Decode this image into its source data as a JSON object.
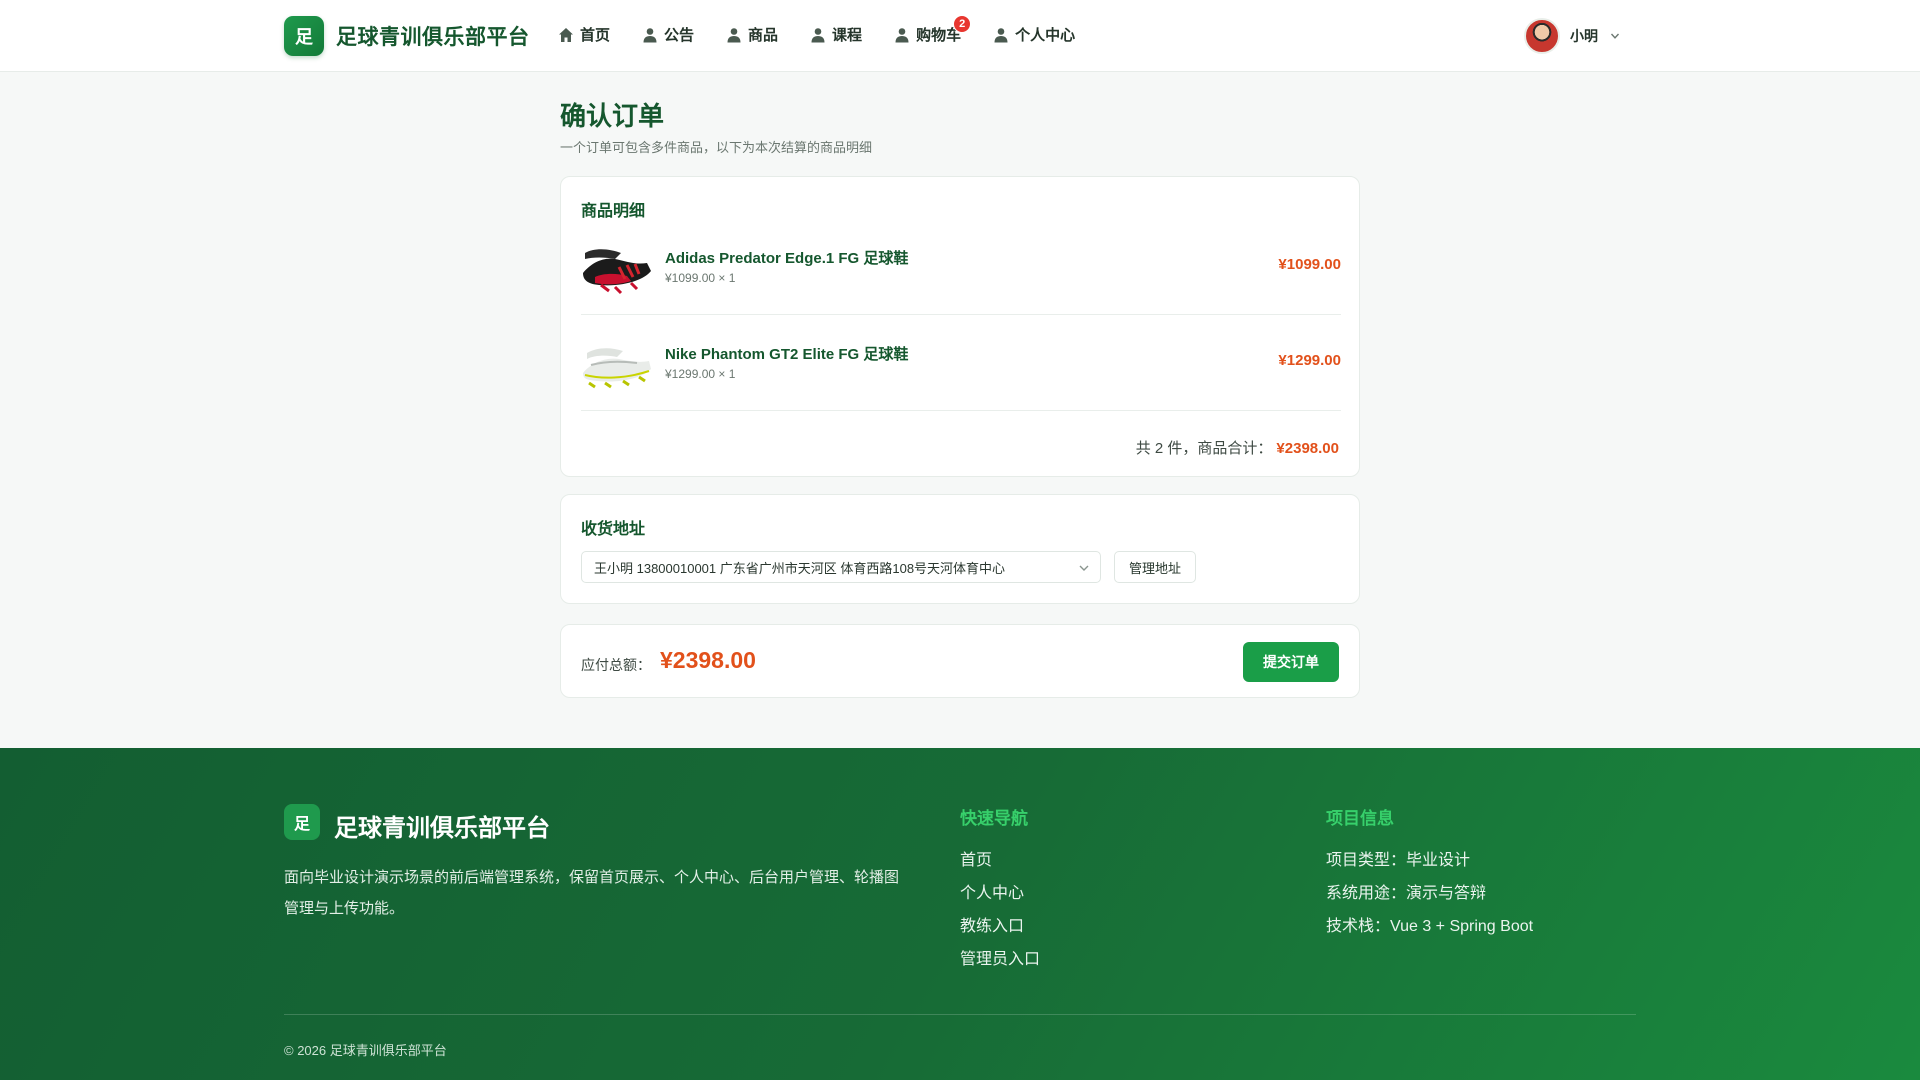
{
  "header": {
    "brand_logo": "足",
    "brand_title": "足球青训俱乐部平台",
    "nav": [
      {
        "label": "首页",
        "icon": "home-icon"
      },
      {
        "label": "公告",
        "icon": "user-icon"
      },
      {
        "label": "商品",
        "icon": "user-icon"
      },
      {
        "label": "课程",
        "icon": "user-icon"
      },
      {
        "label": "购物车",
        "icon": "user-icon",
        "badge": "2"
      },
      {
        "label": "个人中心",
        "icon": "user-icon"
      }
    ],
    "user_name": "小明"
  },
  "page": {
    "title": "确认订单",
    "subtitle": "一个订单可包含多件商品，以下为本次结算的商品明细"
  },
  "goods": {
    "heading": "商品明细",
    "items": [
      {
        "name": "Adidas Predator Edge.1 FG 足球鞋",
        "unit": "¥1099.00 × 1",
        "subtotal": "¥1099.00"
      },
      {
        "name": "Nike Phantom GT2 Elite FG 足球鞋",
        "unit": "¥1299.00 × 1",
        "subtotal": "¥1299.00"
      }
    ],
    "summary_text": "共 2 件，商品合计：",
    "summary_amount": "¥2398.00"
  },
  "address": {
    "heading": "收货地址",
    "selected": "王小明 13800010001 广东省广州市天河区 体育西路108号天河体育中心",
    "manage_label": "管理地址"
  },
  "payment": {
    "label": "应付总额：",
    "amount": "¥2398.00",
    "submit_label": "提交订单"
  },
  "footer": {
    "logo": "足",
    "title": "足球青训俱乐部平台",
    "description": "面向毕业设计演示场景的前后端管理系统，保留首页展示、个人中心、后台用户管理、轮播图管理与上传功能。",
    "quick_nav": {
      "heading": "快速导航",
      "links": [
        "首页",
        "个人中心",
        "教练入口",
        "管理员入口"
      ]
    },
    "project": {
      "heading": "项目信息",
      "lines": [
        "项目类型：毕业设计",
        "系统用途：演示与答辩",
        "技术栈：Vue 3 + Spring Boot"
      ]
    },
    "copyright": "© 2026 足球青训俱乐部平台"
  },
  "colors": {
    "brand_green": "#15572e",
    "accent_green": "#1a9e48",
    "price_orange": "#e2511b",
    "badge_red": "#e8362f"
  }
}
